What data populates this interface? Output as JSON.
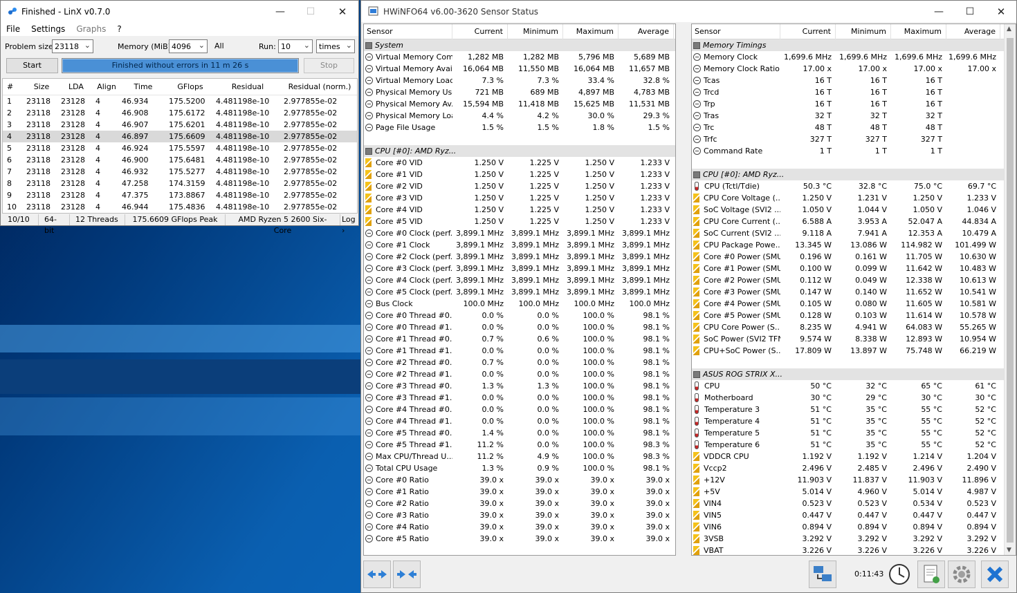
{
  "linx": {
    "title": "Finished - LinX v0.7.0",
    "win_min": "—",
    "win_max": "☐",
    "win_close": "✕",
    "menu": [
      "File",
      "Settings",
      "Graphs",
      "?"
    ],
    "problem_size_label": "Problem size:",
    "problem_size": "23118",
    "memory_label": "Memory (MiB):",
    "memory": "4096",
    "all_label": "All",
    "run_label": "Run:",
    "run": "10",
    "run_unit": "times",
    "start_label": "Start",
    "progress_text": "Finished without errors in 11 m 26 s",
    "stop_label": "Stop",
    "columns": [
      "#",
      "Size",
      "LDA",
      "Align",
      "Time",
      "GFlops",
      "Residual",
      "Residual (norm.)"
    ],
    "rows": [
      [
        "1",
        "23118",
        "23128",
        "4",
        "46.934",
        "175.5200",
        "4.481198e-10",
        "2.977855e-02"
      ],
      [
        "2",
        "23118",
        "23128",
        "4",
        "46.908",
        "175.6172",
        "4.481198e-10",
        "2.977855e-02"
      ],
      [
        "3",
        "23118",
        "23128",
        "4",
        "46.907",
        "175.6201",
        "4.481198e-10",
        "2.977855e-02"
      ],
      [
        "4",
        "23118",
        "23128",
        "4",
        "46.897",
        "175.6609",
        "4.481198e-10",
        "2.977855e-02"
      ],
      [
        "5",
        "23118",
        "23128",
        "4",
        "46.924",
        "175.5597",
        "4.481198e-10",
        "2.977855e-02"
      ],
      [
        "6",
        "23118",
        "23128",
        "4",
        "46.900",
        "175.6481",
        "4.481198e-10",
        "2.977855e-02"
      ],
      [
        "7",
        "23118",
        "23128",
        "4",
        "46.932",
        "175.5277",
        "4.481198e-10",
        "2.977855e-02"
      ],
      [
        "8",
        "23118",
        "23128",
        "4",
        "47.258",
        "174.3159",
        "4.481198e-10",
        "2.977855e-02"
      ],
      [
        "9",
        "23118",
        "23128",
        "4",
        "47.375",
        "173.8867",
        "4.481198e-10",
        "2.977855e-02"
      ],
      [
        "10",
        "23118",
        "23128",
        "4",
        "46.944",
        "175.4836",
        "4.481198e-10",
        "2.977855e-02"
      ]
    ],
    "selected_row": 3,
    "status": [
      "10/10",
      "64-bit",
      "12 Threads",
      "175.6609 GFlops Peak",
      "AMD Ryzen 5 2600 Six-Core",
      "Log ›"
    ]
  },
  "hwinfo": {
    "title": "HWiNFO64 v6.00-3620 Sensor Status",
    "win_min": "—",
    "win_max": "☐",
    "win_close": "✕",
    "columns": [
      "Sensor",
      "Current",
      "Minimum",
      "Maximum",
      "Average"
    ],
    "left": [
      {
        "g": "System"
      },
      {
        "i": "clock",
        "n": "Virtual Memory Com...",
        "v": [
          "1,282 MB",
          "1,282 MB",
          "5,796 MB",
          "5,689 MB"
        ]
      },
      {
        "i": "clock",
        "n": "Virtual Memory Avai...",
        "v": [
          "16,064 MB",
          "11,550 MB",
          "16,064 MB",
          "11,657 MB"
        ]
      },
      {
        "i": "clock",
        "n": "Virtual Memory Load",
        "v": [
          "7.3 %",
          "7.3 %",
          "33.4 %",
          "32.8 %"
        ]
      },
      {
        "i": "clock",
        "n": "Physical Memory Used",
        "v": [
          "721 MB",
          "689 MB",
          "4,897 MB",
          "4,783 MB"
        ]
      },
      {
        "i": "clock",
        "n": "Physical Memory Av...",
        "v": [
          "15,594 MB",
          "11,418 MB",
          "15,625 MB",
          "11,531 MB"
        ]
      },
      {
        "i": "clock",
        "n": "Physical Memory Load",
        "v": [
          "4.4 %",
          "4.2 %",
          "30.0 %",
          "29.3 %"
        ]
      },
      {
        "i": "clock",
        "n": "Page File Usage",
        "v": [
          "1.5 %",
          "1.5 %",
          "1.8 %",
          "1.5 %"
        ]
      },
      {
        "blank": true
      },
      {
        "g": "CPU [#0]: AMD Ryz..."
      },
      {
        "i": "volt",
        "n": "Core #0 VID",
        "v": [
          "1.250 V",
          "1.225 V",
          "1.250 V",
          "1.233 V"
        ]
      },
      {
        "i": "volt",
        "n": "Core #1 VID",
        "v": [
          "1.250 V",
          "1.225 V",
          "1.250 V",
          "1.233 V"
        ]
      },
      {
        "i": "volt",
        "n": "Core #2 VID",
        "v": [
          "1.250 V",
          "1.225 V",
          "1.250 V",
          "1.233 V"
        ]
      },
      {
        "i": "volt",
        "n": "Core #3 VID",
        "v": [
          "1.250 V",
          "1.225 V",
          "1.250 V",
          "1.233 V"
        ]
      },
      {
        "i": "volt",
        "n": "Core #4 VID",
        "v": [
          "1.250 V",
          "1.225 V",
          "1.250 V",
          "1.233 V"
        ]
      },
      {
        "i": "volt",
        "n": "Core #5 VID",
        "v": [
          "1.250 V",
          "1.225 V",
          "1.250 V",
          "1.233 V"
        ]
      },
      {
        "i": "clock",
        "n": "Core #0 Clock (perf...",
        "v": [
          "3,899.1 MHz",
          "3,899.1 MHz",
          "3,899.1 MHz",
          "3,899.1 MHz"
        ]
      },
      {
        "i": "clock",
        "n": "Core #1 Clock",
        "v": [
          "3,899.1 MHz",
          "3,899.1 MHz",
          "3,899.1 MHz",
          "3,899.1 MHz"
        ]
      },
      {
        "i": "clock",
        "n": "Core #2 Clock (perf...",
        "v": [
          "3,899.1 MHz",
          "3,899.1 MHz",
          "3,899.1 MHz",
          "3,899.1 MHz"
        ]
      },
      {
        "i": "clock",
        "n": "Core #3 Clock (perf...",
        "v": [
          "3,899.1 MHz",
          "3,899.1 MHz",
          "3,899.1 MHz",
          "3,899.1 MHz"
        ]
      },
      {
        "i": "clock",
        "n": "Core #4 Clock (perf...",
        "v": [
          "3,899.1 MHz",
          "3,899.1 MHz",
          "3,899.1 MHz",
          "3,899.1 MHz"
        ]
      },
      {
        "i": "clock",
        "n": "Core #5 Clock (perf...",
        "v": [
          "3,899.1 MHz",
          "3,899.1 MHz",
          "3,899.1 MHz",
          "3,899.1 MHz"
        ]
      },
      {
        "i": "clock",
        "n": "Bus Clock",
        "v": [
          "100.0 MHz",
          "100.0 MHz",
          "100.0 MHz",
          "100.0 MHz"
        ]
      },
      {
        "i": "clock",
        "n": "Core #0 Thread #0...",
        "v": [
          "0.0 %",
          "0.0 %",
          "100.0 %",
          "98.1 %"
        ]
      },
      {
        "i": "clock",
        "n": "Core #0 Thread #1...",
        "v": [
          "0.0 %",
          "0.0 %",
          "100.0 %",
          "98.1 %"
        ]
      },
      {
        "i": "clock",
        "n": "Core #1 Thread #0...",
        "v": [
          "0.7 %",
          "0.6 %",
          "100.0 %",
          "98.1 %"
        ]
      },
      {
        "i": "clock",
        "n": "Core #1 Thread #1...",
        "v": [
          "0.0 %",
          "0.0 %",
          "100.0 %",
          "98.1 %"
        ]
      },
      {
        "i": "clock",
        "n": "Core #2 Thread #0...",
        "v": [
          "0.7 %",
          "0.0 %",
          "100.0 %",
          "98.1 %"
        ]
      },
      {
        "i": "clock",
        "n": "Core #2 Thread #1...",
        "v": [
          "0.0 %",
          "0.0 %",
          "100.0 %",
          "98.1 %"
        ]
      },
      {
        "i": "clock",
        "n": "Core #3 Thread #0...",
        "v": [
          "1.3 %",
          "1.3 %",
          "100.0 %",
          "98.1 %"
        ]
      },
      {
        "i": "clock",
        "n": "Core #3 Thread #1...",
        "v": [
          "0.0 %",
          "0.0 %",
          "100.0 %",
          "98.1 %"
        ]
      },
      {
        "i": "clock",
        "n": "Core #4 Thread #0...",
        "v": [
          "0.0 %",
          "0.0 %",
          "100.0 %",
          "98.1 %"
        ]
      },
      {
        "i": "clock",
        "n": "Core #4 Thread #1...",
        "v": [
          "0.0 %",
          "0.0 %",
          "100.0 %",
          "98.1 %"
        ]
      },
      {
        "i": "clock",
        "n": "Core #5 Thread #0...",
        "v": [
          "1.4 %",
          "0.0 %",
          "100.0 %",
          "98.1 %"
        ]
      },
      {
        "i": "clock",
        "n": "Core #5 Thread #1...",
        "v": [
          "11.2 %",
          "0.0 %",
          "100.0 %",
          "98.3 %"
        ]
      },
      {
        "i": "clock",
        "n": "Max CPU/Thread U...",
        "v": [
          "11.2 %",
          "4.9 %",
          "100.0 %",
          "98.3 %"
        ]
      },
      {
        "i": "clock",
        "n": "Total CPU Usage",
        "v": [
          "1.3 %",
          "0.9 %",
          "100.0 %",
          "98.1 %"
        ]
      },
      {
        "i": "clock",
        "n": "Core #0 Ratio",
        "v": [
          "39.0 x",
          "39.0 x",
          "39.0 x",
          "39.0 x"
        ]
      },
      {
        "i": "clock",
        "n": "Core #1 Ratio",
        "v": [
          "39.0 x",
          "39.0 x",
          "39.0 x",
          "39.0 x"
        ]
      },
      {
        "i": "clock",
        "n": "Core #2 Ratio",
        "v": [
          "39.0 x",
          "39.0 x",
          "39.0 x",
          "39.0 x"
        ]
      },
      {
        "i": "clock",
        "n": "Core #3 Ratio",
        "v": [
          "39.0 x",
          "39.0 x",
          "39.0 x",
          "39.0 x"
        ]
      },
      {
        "i": "clock",
        "n": "Core #4 Ratio",
        "v": [
          "39.0 x",
          "39.0 x",
          "39.0 x",
          "39.0 x"
        ]
      },
      {
        "i": "clock",
        "n": "Core #5 Ratio",
        "v": [
          "39.0 x",
          "39.0 x",
          "39.0 x",
          "39.0 x"
        ]
      }
    ],
    "right": [
      {
        "g": "Memory Timings"
      },
      {
        "i": "clock",
        "n": "Memory Clock",
        "v": [
          "1,699.6 MHz",
          "1,699.6 MHz",
          "1,699.6 MHz",
          "1,699.6 MHz"
        ]
      },
      {
        "i": "clock",
        "n": "Memory Clock Ratio",
        "v": [
          "17.00 x",
          "17.00 x",
          "17.00 x",
          "17.00 x"
        ]
      },
      {
        "i": "clock",
        "n": "Tcas",
        "v": [
          "16 T",
          "16 T",
          "16 T",
          ""
        ]
      },
      {
        "i": "clock",
        "n": "Trcd",
        "v": [
          "16 T",
          "16 T",
          "16 T",
          ""
        ]
      },
      {
        "i": "clock",
        "n": "Trp",
        "v": [
          "16 T",
          "16 T",
          "16 T",
          ""
        ]
      },
      {
        "i": "clock",
        "n": "Tras",
        "v": [
          "32 T",
          "32 T",
          "32 T",
          ""
        ]
      },
      {
        "i": "clock",
        "n": "Trc",
        "v": [
          "48 T",
          "48 T",
          "48 T",
          ""
        ]
      },
      {
        "i": "clock",
        "n": "Trfc",
        "v": [
          "327 T",
          "327 T",
          "327 T",
          ""
        ]
      },
      {
        "i": "clock",
        "n": "Command Rate",
        "v": [
          "1 T",
          "1 T",
          "1 T",
          ""
        ]
      },
      {
        "blank": true
      },
      {
        "g": "CPU [#0]: AMD Ryz..."
      },
      {
        "i": "temp",
        "n": "CPU (Tctl/Tdie)",
        "v": [
          "50.3 °C",
          "32.8 °C",
          "75.0 °C",
          "69.7 °C"
        ]
      },
      {
        "i": "volt",
        "n": "CPU Core Voltage (...",
        "v": [
          "1.250 V",
          "1.231 V",
          "1.250 V",
          "1.233 V"
        ]
      },
      {
        "i": "volt",
        "n": "SoC Voltage (SVI2 ...",
        "v": [
          "1.050 V",
          "1.044 V",
          "1.050 V",
          "1.046 V"
        ]
      },
      {
        "i": "volt",
        "n": "CPU Core Current (...",
        "v": [
          "6.588 A",
          "3.953 A",
          "52.047 A",
          "44.834 A"
        ]
      },
      {
        "i": "volt",
        "n": "SoC Current (SVI2 ...",
        "v": [
          "9.118 A",
          "7.941 A",
          "12.353 A",
          "10.479 A"
        ]
      },
      {
        "i": "volt",
        "n": "CPU Package Powe...",
        "v": [
          "13.345 W",
          "13.086 W",
          "114.982 W",
          "101.499 W"
        ]
      },
      {
        "i": "volt",
        "n": "Core #0 Power (SMU)",
        "v": [
          "0.196 W",
          "0.161 W",
          "11.705 W",
          "10.630 W"
        ]
      },
      {
        "i": "volt",
        "n": "Core #1 Power (SMU)",
        "v": [
          "0.100 W",
          "0.099 W",
          "11.642 W",
          "10.483 W"
        ]
      },
      {
        "i": "volt",
        "n": "Core #2 Power (SMU)",
        "v": [
          "0.112 W",
          "0.049 W",
          "12.338 W",
          "10.613 W"
        ]
      },
      {
        "i": "volt",
        "n": "Core #3 Power (SMU)",
        "v": [
          "0.147 W",
          "0.140 W",
          "11.652 W",
          "10.541 W"
        ]
      },
      {
        "i": "volt",
        "n": "Core #4 Power (SMU)",
        "v": [
          "0.105 W",
          "0.080 W",
          "11.605 W",
          "10.581 W"
        ]
      },
      {
        "i": "volt",
        "n": "Core #5 Power (SMU)",
        "v": [
          "0.128 W",
          "0.103 W",
          "11.614 W",
          "10.578 W"
        ]
      },
      {
        "i": "volt",
        "n": "CPU Core Power (S...",
        "v": [
          "8.235 W",
          "4.941 W",
          "64.083 W",
          "55.265 W"
        ]
      },
      {
        "i": "volt",
        "n": "SoC Power (SVI2 TFN)",
        "v": [
          "9.574 W",
          "8.338 W",
          "12.893 W",
          "10.954 W"
        ]
      },
      {
        "i": "volt",
        "n": "CPU+SoC Power (S...",
        "v": [
          "17.809 W",
          "13.897 W",
          "75.748 W",
          "66.219 W"
        ]
      },
      {
        "blank": true
      },
      {
        "g": "ASUS ROG STRIX X..."
      },
      {
        "i": "temp",
        "n": "CPU",
        "v": [
          "50 °C",
          "32 °C",
          "65 °C",
          "61 °C"
        ]
      },
      {
        "i": "temp",
        "n": "Motherboard",
        "v": [
          "30 °C",
          "29 °C",
          "30 °C",
          "30 °C"
        ]
      },
      {
        "i": "temp",
        "n": "Temperature 3",
        "v": [
          "51 °C",
          "35 °C",
          "55 °C",
          "52 °C"
        ]
      },
      {
        "i": "temp",
        "n": "Temperature 4",
        "v": [
          "51 °C",
          "35 °C",
          "55 °C",
          "52 °C"
        ]
      },
      {
        "i": "temp",
        "n": "Temperature 5",
        "v": [
          "51 °C",
          "35 °C",
          "55 °C",
          "52 °C"
        ]
      },
      {
        "i": "temp",
        "n": "Temperature 6",
        "v": [
          "51 °C",
          "35 °C",
          "55 °C",
          "52 °C"
        ]
      },
      {
        "i": "volt",
        "n": "VDDCR CPU",
        "v": [
          "1.192 V",
          "1.192 V",
          "1.214 V",
          "1.204 V"
        ]
      },
      {
        "i": "volt",
        "n": "Vccp2",
        "v": [
          "2.496 V",
          "2.485 V",
          "2.496 V",
          "2.490 V"
        ]
      },
      {
        "i": "volt",
        "n": "+12V",
        "v": [
          "11.903 V",
          "11.837 V",
          "11.903 V",
          "11.896 V"
        ]
      },
      {
        "i": "volt",
        "n": "+5V",
        "v": [
          "5.014 V",
          "4.960 V",
          "5.014 V",
          "4.987 V"
        ]
      },
      {
        "i": "volt",
        "n": "VIN4",
        "v": [
          "0.523 V",
          "0.523 V",
          "0.534 V",
          "0.523 V"
        ]
      },
      {
        "i": "volt",
        "n": "VIN5",
        "v": [
          "0.447 V",
          "0.447 V",
          "0.447 V",
          "0.447 V"
        ]
      },
      {
        "i": "volt",
        "n": "VIN6",
        "v": [
          "0.894 V",
          "0.894 V",
          "0.894 V",
          "0.894 V"
        ]
      },
      {
        "i": "volt",
        "n": "3VSB",
        "v": [
          "3.292 V",
          "3.292 V",
          "3.292 V",
          "3.292 V"
        ]
      },
      {
        "i": "volt",
        "n": "VBAT",
        "v": [
          "3.226 V",
          "3.226 V",
          "3.226 V",
          "3.226 V"
        ]
      }
    ],
    "timer": "0:11:43",
    "scroll_up": "▲",
    "scroll_down": "▼"
  }
}
